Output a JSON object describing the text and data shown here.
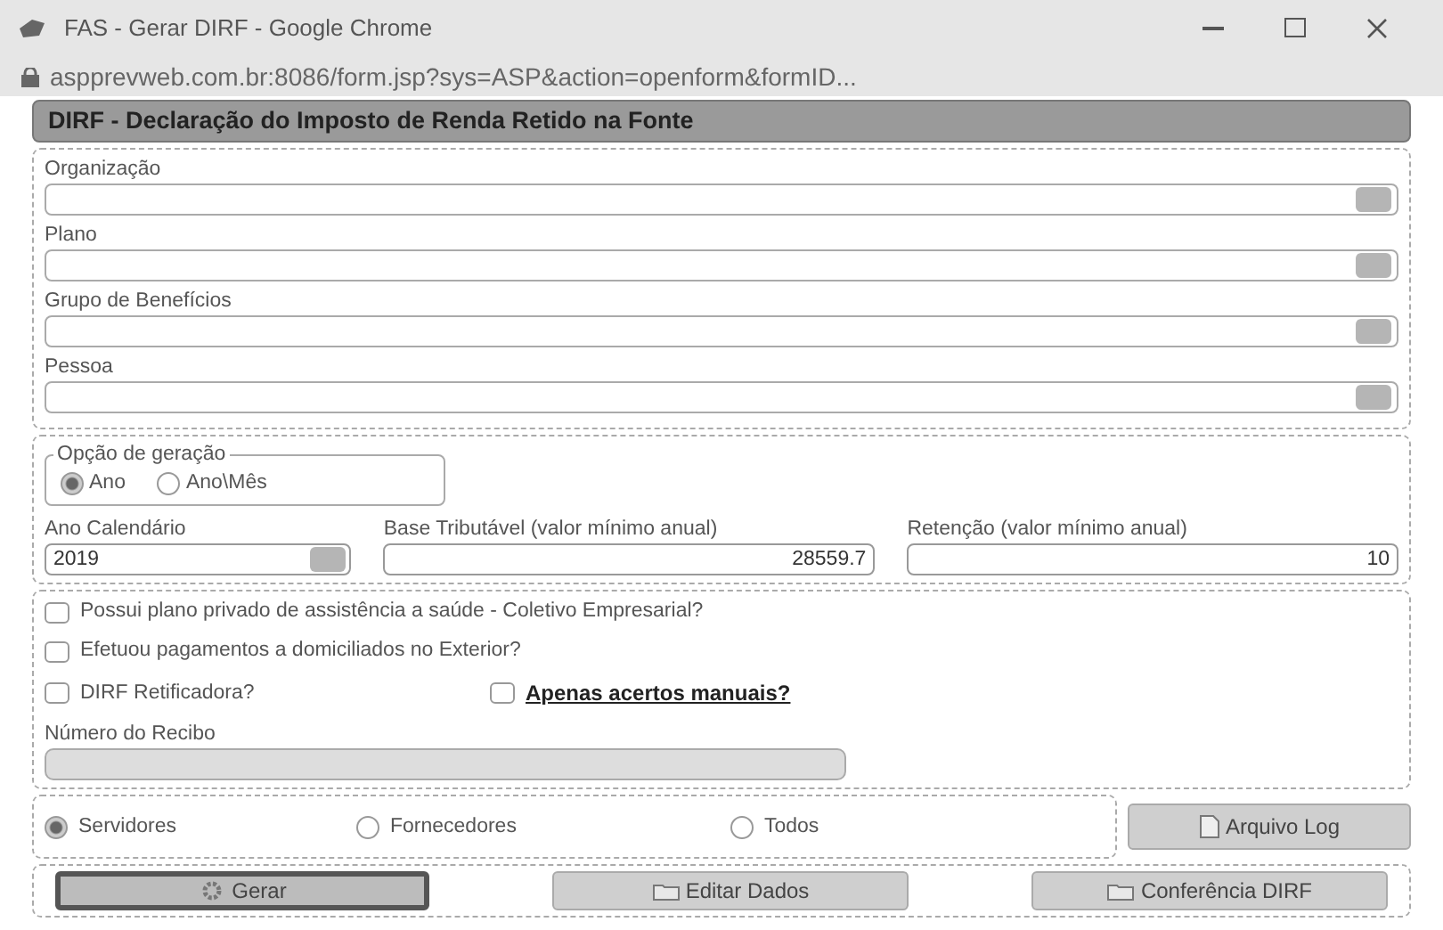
{
  "window": {
    "title": "FAS - Gerar DIRF - Google Chrome",
    "url": "aspprevweb.com.br:8086/form.jsp?sys=ASP&action=openform&formID..."
  },
  "form_title": "DIRF - Declaração do Imposto de Renda Retido na Fonte",
  "selects": [
    {
      "label": "Organização"
    },
    {
      "label": "Plano"
    },
    {
      "label": "Grupo de Benefícios"
    },
    {
      "label": "Pessoa"
    }
  ],
  "generation_option": {
    "legend": "Opção de geração",
    "options": [
      {
        "label": "Ano",
        "selected": true
      },
      {
        "label": "Ano\\Mês",
        "selected": false
      }
    ]
  },
  "fields": [
    {
      "label": "Ano Calendário",
      "value": "2019",
      "kind": "select"
    },
    {
      "label": "Base Tributável  (valor mínimo anual)",
      "value": "28559.7",
      "kind": "number"
    },
    {
      "label": "Retenção (valor mínimo anual)",
      "value": "10",
      "kind": "number"
    }
  ],
  "checkbox_rows": [
    [
      {
        "label": "Possui plano privado de assistência a saúde - Coletivo Empresarial?",
        "checked": false,
        "kind": "plain"
      }
    ],
    [
      {
        "label": "Efetuou pagamentos a domiciliados no Exterior?",
        "checked": false,
        "kind": "plain"
      }
    ],
    [
      {
        "label": "DIRF Retificadora?",
        "checked": false,
        "kind": "plain"
      },
      {
        "label": "Apenas acertos manuais?",
        "checked": false,
        "kind": "link"
      }
    ]
  ],
  "receipt": {
    "label": "Número do Recibo",
    "disabled": true
  },
  "scope": [
    {
      "label": "Servidores",
      "selected": true
    },
    {
      "label": "Fornecedores",
      "selected": false
    },
    {
      "label": "Todos",
      "selected": false
    }
  ],
  "log_button": "Arquivo Log",
  "actions": [
    {
      "label": "Gerar",
      "focused": true
    },
    {
      "label": "Editar Dados",
      "focused": false
    },
    {
      "label": "Conferência DIRF",
      "focused": false
    }
  ]
}
